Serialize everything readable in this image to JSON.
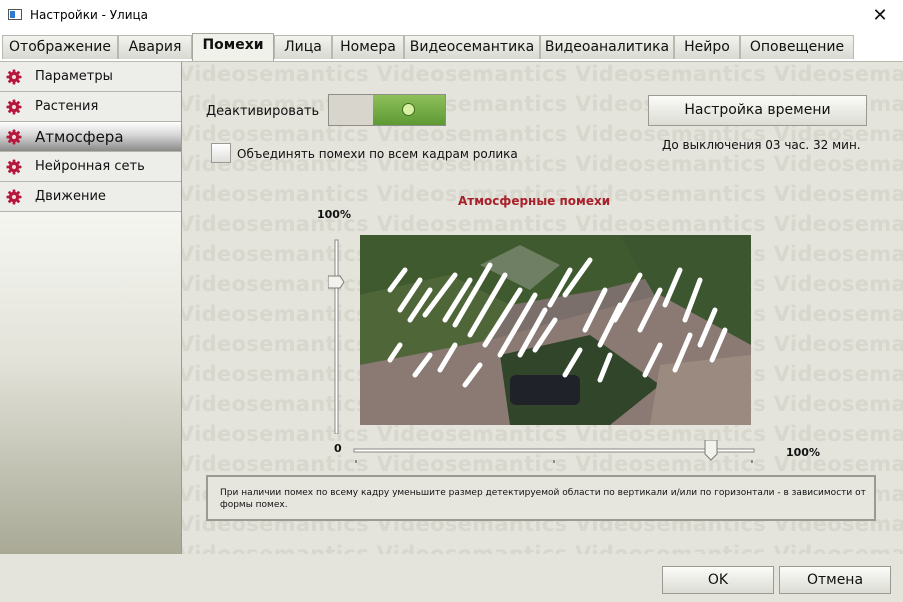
{
  "window": {
    "title": "Настройки - Улица",
    "close_symbol": "✕"
  },
  "tabs": [
    {
      "label": "Отображение",
      "active": false
    },
    {
      "label": "Авария",
      "active": false
    },
    {
      "label": "Помехи",
      "active": true
    },
    {
      "label": "Лица",
      "active": false
    },
    {
      "label": "Номера",
      "active": false
    },
    {
      "label": "Видеосемантика",
      "active": false
    },
    {
      "label": "Видеоаналитика",
      "active": false
    },
    {
      "label": "Нейро",
      "active": false
    },
    {
      "label": "Оповещение",
      "active": false
    }
  ],
  "sidebar": {
    "icon": "gear-icon",
    "icon_color": "#b5183c",
    "items": [
      {
        "label": "Параметры",
        "active": false
      },
      {
        "label": "Растения",
        "active": false
      },
      {
        "label": "Атмосфера",
        "active": true
      },
      {
        "label": "Нейронная сеть",
        "active": false
      },
      {
        "label": "Движение",
        "active": false
      }
    ]
  },
  "watermark": {
    "text": "Videosemantics"
  },
  "controls": {
    "deactivate_label": "Деактивировать",
    "toggle_on": true,
    "time_button": "Настройка времени",
    "timeout_text": "До выключения 03 час. 32 мин.",
    "merge_checkbox_label": "Объединять помехи по всем кадрам ролика",
    "merge_checked": false
  },
  "section_title": "Атмосферные помехи",
  "vertical_slider": {
    "top_label": "100%",
    "bottom_label": "0",
    "value_percent": 75
  },
  "horizontal_slider": {
    "right_label": "100%",
    "value_percent": 89
  },
  "hint": "При наличии помех по всему кадру уменьшите размер детектируемой области по вертикали и/или по горизонтали - в зависимости от формы помех.",
  "footer": {
    "ok_label": "OK",
    "cancel_label": "Отмена"
  },
  "colors": {
    "accent_red": "#b5183c",
    "toggle_green": "#6fa640",
    "title_red": "#a8202a"
  }
}
